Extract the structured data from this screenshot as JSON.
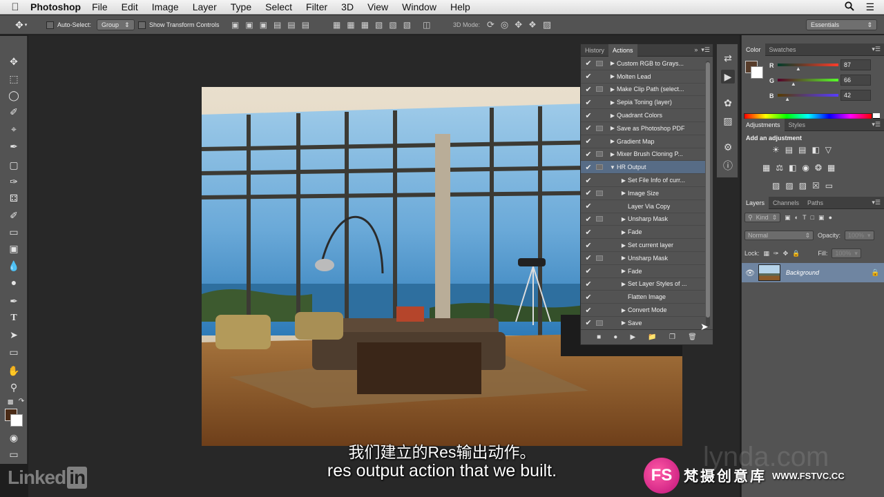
{
  "menubar": {
    "app": "Photoshop",
    "items": [
      "File",
      "Edit",
      "Image",
      "Layer",
      "Type",
      "Select",
      "Filter",
      "3D",
      "View",
      "Window",
      "Help"
    ]
  },
  "options": {
    "auto_select_label": "Auto-Select:",
    "auto_select_value": "Group",
    "transform_label": "Show Transform Controls",
    "mode_label": "3D Mode:",
    "workspace": "Essentials"
  },
  "actions_panel": {
    "tabs": [
      "History",
      "Actions"
    ],
    "rows": [
      {
        "label": "Custom RGB to Grays...",
        "dialog": true,
        "expander": "right",
        "child": false
      },
      {
        "label": "Molten Lead",
        "dialog": false,
        "expander": "right",
        "child": false
      },
      {
        "label": "Make Clip Path (select...",
        "dialog": true,
        "expander": "right",
        "child": false
      },
      {
        "label": "Sepia Toning (layer)",
        "dialog": false,
        "expander": "right",
        "child": false
      },
      {
        "label": "Quadrant Colors",
        "dialog": false,
        "expander": "right",
        "child": false
      },
      {
        "label": "Save as Photoshop PDF",
        "dialog": true,
        "expander": "right",
        "child": false
      },
      {
        "label": "Gradient Map",
        "dialog": false,
        "expander": "right",
        "child": false
      },
      {
        "label": "Mixer Brush Cloning P...",
        "dialog": true,
        "expander": "right",
        "child": false
      },
      {
        "label": "HR Output",
        "dialog": true,
        "expander": "down",
        "child": false,
        "selected": true
      },
      {
        "label": "Set File Info of curr...",
        "dialog": false,
        "expander": "right",
        "child": true
      },
      {
        "label": "Image Size",
        "dialog": true,
        "expander": "right",
        "child": true
      },
      {
        "label": "Layer Via Copy",
        "dialog": false,
        "expander": "none",
        "child": true
      },
      {
        "label": "Unsharp Mask",
        "dialog": true,
        "expander": "right",
        "child": true
      },
      {
        "label": "Fade",
        "dialog": false,
        "expander": "right",
        "child": true
      },
      {
        "label": "Set current layer",
        "dialog": false,
        "expander": "right",
        "child": true
      },
      {
        "label": "Unsharp Mask",
        "dialog": true,
        "expander": "right",
        "child": true
      },
      {
        "label": "Fade",
        "dialog": false,
        "expander": "right",
        "child": true
      },
      {
        "label": "Set Layer Styles of ...",
        "dialog": false,
        "expander": "right",
        "child": true
      },
      {
        "label": "Flatten Image",
        "dialog": false,
        "expander": "none",
        "child": true
      },
      {
        "label": "Convert Mode",
        "dialog": false,
        "expander": "right",
        "child": true
      },
      {
        "label": "Save",
        "dialog": true,
        "expander": "right",
        "child": true
      }
    ]
  },
  "color_panel": {
    "tabs": [
      "Color",
      "Swatches"
    ],
    "r": "87",
    "g": "66",
    "b": "42",
    "r_frac": 0.34,
    "g_frac": 0.26,
    "b_frac": 0.16,
    "fg_color": "#573c2a"
  },
  "adjustments": {
    "tabs": [
      "Adjustments",
      "Styles"
    ],
    "title": "Add an adjustment"
  },
  "layers_panel": {
    "tabs": [
      "Layers",
      "Channels",
      "Paths"
    ],
    "filter": "Kind",
    "blend": "Normal",
    "opacity_label": "Opacity:",
    "opacity": "100%",
    "lock_label": "Lock:",
    "fill_label": "Fill:",
    "fill": "100%",
    "layer_name": "Background"
  },
  "subtitle": {
    "cn": "我们建立的Res输出动作。",
    "en": "res output action that we built."
  },
  "watermarks": {
    "linkedin": "Linked",
    "linkedin_box": "in",
    "lynda": "lynda.com",
    "fs_logo": "FS",
    "fs_name": "梵摄创意库",
    "fs_url": "WWW.FSTVC.CC"
  }
}
